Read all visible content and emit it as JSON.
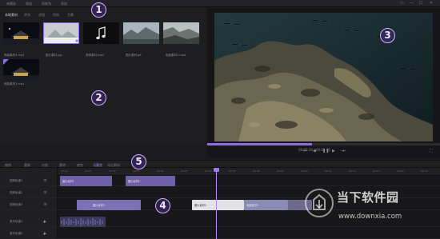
{
  "topbar": {
    "items": [
      "未保存",
      "导出",
      "另存为",
      "导出"
    ],
    "window_controls": [
      "▭",
      "—",
      "☐",
      "✕"
    ]
  },
  "media": {
    "tabs": [
      "本地素材",
      "转场",
      "滤镜",
      "特效",
      "字幕"
    ],
    "thumbnails": [
      {
        "caption": "电脑素材4.mp4"
      },
      {
        "caption": "图片素材.jpg"
      },
      {
        "caption": "音频素材.mp3"
      },
      {
        "caption": "图片素材.gif"
      },
      {
        "caption": "电脑素材3.mp4"
      },
      {
        "caption": "电脑素材1.mp4"
      }
    ]
  },
  "preview": {
    "timecode": "00:05:30 / 00:02:10",
    "progress": 0.45,
    "controls": [
      "⏮",
      "◀",
      "❚❚",
      "▶",
      "⏭"
    ],
    "fullscreen_icon": "⛶"
  },
  "toolbar": {
    "tools": [
      "撤销",
      "重做",
      "分割",
      "删除",
      "裁剪",
      "马赛克",
      "导出素材"
    ]
  },
  "timeline": {
    "ruler_ticks": [
      "00:00",
      "00:01",
      "00:02",
      "00:03",
      "00:04",
      "00:05",
      "00:06",
      "00:07",
      "00:08",
      "00:09",
      "00:10",
      "00:11",
      "00:12",
      "00:13",
      "00:14",
      "00:15"
    ],
    "tracks": [
      {
        "label": "视频轨道1"
      },
      {
        "label": "视频轨道2"
      },
      {
        "label": "视频轨道3"
      },
      {
        "label": "音乐轨道1"
      },
      {
        "label": "音乐轨道2"
      }
    ],
    "clips": {
      "c1": "图片素材1",
      "c2": "图片素材2",
      "c3": "图片素材3",
      "c4": "图片素材2",
      "c5": "电脑素材3"
    }
  },
  "markers": [
    "1",
    "2",
    "3",
    "4",
    "5"
  ],
  "watermark": {
    "title": "当下软件园",
    "url": "www.downxia.com"
  }
}
